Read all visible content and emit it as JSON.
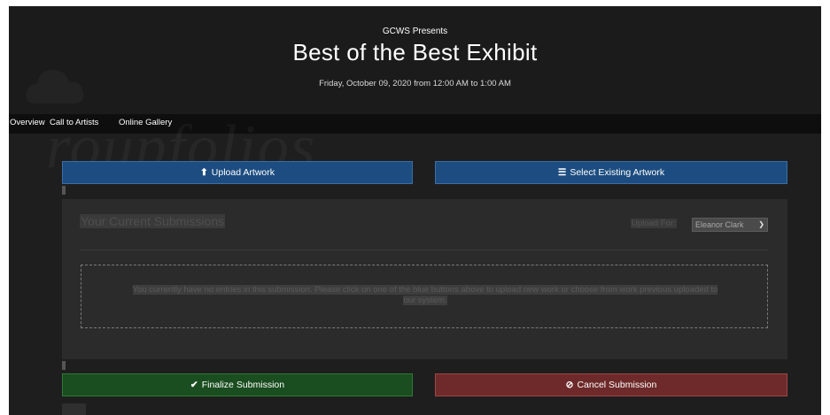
{
  "header": {
    "presents": "GCWS Presents",
    "title": "Best of the Best Exhibit",
    "dateline": "Friday, October 09, 2020 from 12:00 AM to 1:00 AM"
  },
  "nav": {
    "items": [
      {
        "label": "Overview"
      },
      {
        "label": "Call to Artists"
      },
      {
        "label": "Online Gallery"
      }
    ]
  },
  "watermark": {
    "text": "roupfolios",
    "icon": "cloud-icon"
  },
  "actions": {
    "upload": {
      "label": "Upload Artwork",
      "icon": "upload-icon",
      "glyph": "⬆"
    },
    "select": {
      "label": "Select Existing Artwork",
      "icon": "list-icon",
      "glyph": "☰"
    },
    "finalize": {
      "label": "Finalize Submission",
      "icon": "check-icon",
      "glyph": "✔"
    },
    "cancel": {
      "label": "Cancel Submission",
      "icon": "ban-icon",
      "glyph": "⊘"
    }
  },
  "submissions": {
    "title": "Your Current Submissions",
    "upload_for_label": "Upload For:",
    "upload_for_value": "Eleanor Clark",
    "empty_message": "You currently have no entries in this submission. Please click on one of the blue buttons above to upload new work or choose from work previous uploaded to our system."
  },
  "colors": {
    "primary": "#1d4d80",
    "success": "#1a4d1f",
    "danger": "#6e2a2a",
    "background": "#1e1e1e",
    "navbar": "#0e0e0e"
  }
}
